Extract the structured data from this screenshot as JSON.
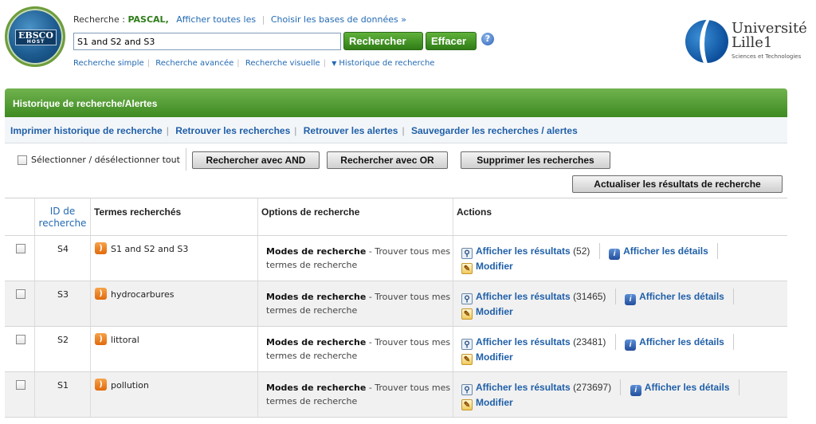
{
  "header": {
    "logo_text": "EBSCO",
    "logo_sub": "HOST",
    "search_label": "Recherche :",
    "database": "PASCAL,",
    "show_all": "Afficher toutes les",
    "choose_db": "Choisir les bases de données »",
    "query": "S1 and S2 and S3",
    "search_button": "Rechercher",
    "clear_button": "Effacer",
    "help_glyph": "?",
    "nav": [
      "Recherche simple",
      "Recherche avancée",
      "Recherche visuelle",
      "Historique de recherche"
    ],
    "university_name_1": "Université",
    "university_name_2": "Lille1",
    "university_sub": "Sciences et Technologies"
  },
  "panel": {
    "title": "Historique de recherche/Alertes",
    "links": [
      "Imprimer historique de recherche",
      "Retrouver les recherches",
      "Retrouver les alertes",
      "Sauvegarder les recherches / alertes"
    ]
  },
  "toolbar": {
    "select_all": "Sélectionner / désélectionner tout",
    "btn_and": "Rechercher avec AND",
    "btn_or": "Rechercher avec OR",
    "btn_delete": "Supprimer les recherches",
    "btn_refresh": "Actualiser les résultats de recherche"
  },
  "table": {
    "headers": {
      "id_line1": "ID de",
      "id_line2": "recherche",
      "terms": "Termes recherchés",
      "options": "Options de recherche",
      "actions": "Actions"
    },
    "rows": [
      {
        "id": "S4",
        "term": "S1 and S2 and S3",
        "mode_label": "Modes de recherche",
        "mode_text": " - Trouver tous mes termes de recherche",
        "show_results": "Afficher les résultats",
        "count": "(52)",
        "show_details": "Afficher les détails",
        "edit": "Modifier"
      },
      {
        "id": "S3",
        "term": "hydrocarbures",
        "mode_label": "Modes de recherche",
        "mode_text": " - Trouver tous mes termes de recherche",
        "show_results": "Afficher les résultats",
        "count": "(31465)",
        "show_details": "Afficher les détails",
        "edit": "Modifier"
      },
      {
        "id": "S2",
        "term": "littoral",
        "mode_label": "Modes de recherche",
        "mode_text": " - Trouver tous mes termes de recherche",
        "show_results": "Afficher les résultats",
        "count": "(23481)",
        "show_details": "Afficher les détails",
        "edit": "Modifier"
      },
      {
        "id": "S1",
        "term": "pollution",
        "mode_label": "Modes de recherche",
        "mode_text": " - Trouver tous mes termes de recherche",
        "show_results": "Afficher les résultats",
        "count": "(273697)",
        "show_details": "Afficher les détails",
        "edit": "Modifier"
      }
    ]
  },
  "icons": {
    "rss": "rss-feed-icon",
    "results": "magnifier-icon",
    "details": "info-icon",
    "edit": "pencil-edit-icon"
  },
  "colors": {
    "green_header": "#4f9a30",
    "link_blue": "#1f5fa8",
    "db_green": "#2e7d1a"
  }
}
